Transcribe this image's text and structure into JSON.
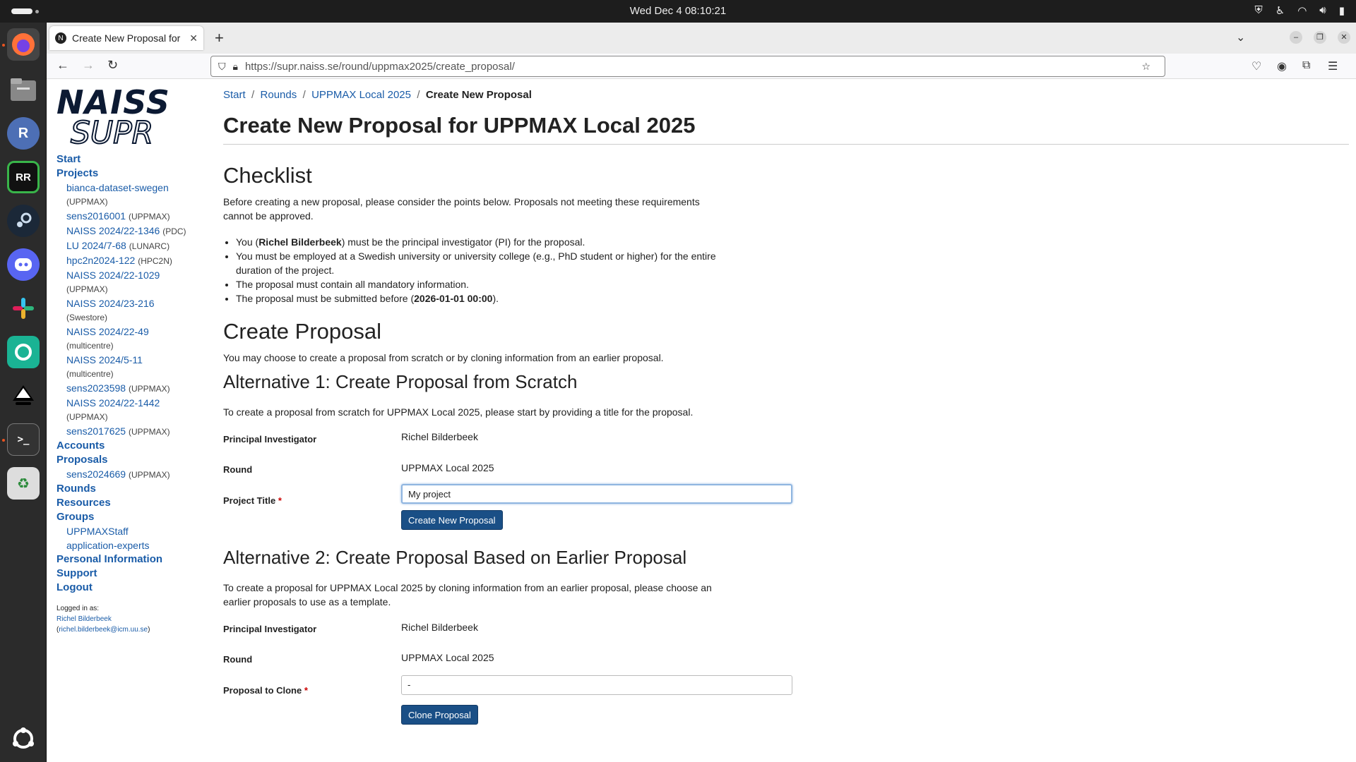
{
  "topbar": {
    "clock": "Wed Dec 4  08:10:21",
    "tray": [
      "shield-icon",
      "accessibility-icon",
      "wifi-icon",
      "volume-icon",
      "battery-icon"
    ]
  },
  "dock": {
    "items": [
      "firefox",
      "files",
      "r-app",
      "rstudio",
      "steam",
      "discord",
      "slack",
      "gitkraken",
      "inkscape",
      "terminal",
      "trash",
      "show-apps"
    ]
  },
  "browser": {
    "tab_title": "Create New Proposal for",
    "favicon_letter": "N",
    "url": "https://supr.naiss.se/round/uppmax2025/create_proposal/"
  },
  "sidebar": {
    "logo_line1": "NAISS",
    "logo_line2": "SUPR",
    "start": "Start",
    "projects": "Projects",
    "project_items": [
      {
        "name": "bianca-dataset-swegen",
        "tag": "(UPPMAX)",
        "wrap": true
      },
      {
        "name": "sens2016001",
        "tag": "(UPPMAX)",
        "wrap": false
      },
      {
        "name": "NAISS 2024/22-1346",
        "tag": "(PDC)",
        "wrap": false
      },
      {
        "name": "LU 2024/7-68",
        "tag": "(LUNARC)",
        "wrap": false
      },
      {
        "name": "hpc2n2024-122",
        "tag": "(HPC2N)",
        "wrap": false
      },
      {
        "name": "NAISS 2024/22-1029",
        "tag": "(UPPMAX)",
        "wrap": true
      },
      {
        "name": "NAISS 2024/23-216",
        "tag": "(Swestore)",
        "wrap": true
      },
      {
        "name": "NAISS 2024/22-49",
        "tag": "(multicentre)",
        "wrap": true
      },
      {
        "name": "NAISS 2024/5-11",
        "tag": "(multicentre)",
        "wrap": true
      },
      {
        "name": "sens2023598",
        "tag": "(UPPMAX)",
        "wrap": false
      },
      {
        "name": "NAISS 2024/22-1442",
        "tag": "(UPPMAX)",
        "wrap": true
      },
      {
        "name": "sens2017625",
        "tag": "(UPPMAX)",
        "wrap": false
      }
    ],
    "accounts": "Accounts",
    "proposals": "Proposals",
    "proposal_item": {
      "name": "sens2024669",
      "tag": "(UPPMAX)"
    },
    "rounds": "Rounds",
    "resources": "Resources",
    "groups": "Groups",
    "group_items": [
      "UPPMAXStaff",
      "application-experts"
    ],
    "personal": "Personal Information",
    "support": "Support",
    "logout": "Logout",
    "logged_in_as": "Logged in as:",
    "user_name": "Richel Bilderbeek",
    "user_email": "richel.bilderbeek@icm.uu.se"
  },
  "breadcrumb": {
    "start": "Start",
    "rounds": "Rounds",
    "round": "UPPMAX Local 2025",
    "current": "Create New Proposal"
  },
  "page_title": "Create New Proposal for UPPMAX Local 2025",
  "checklist": {
    "heading": "Checklist",
    "intro": "Before creating a new proposal, please consider the points below. Proposals not meeting these requirements cannot be approved.",
    "b1_pre": "You (",
    "b1_name": "Richel Bilderbeek",
    "b1_post": ") must be the principal investigator (PI) for the proposal.",
    "b2": "You must be employed at a Swedish university or university college (e.g., PhD student or higher) for the entire duration of the project.",
    "b3": "The proposal must contain all mandatory information.",
    "b4_pre": "The proposal must be submitted before (",
    "b4_date": "2026-01-01 00:00",
    "b4_post": ")."
  },
  "create": {
    "heading": "Create Proposal",
    "intro": "You may choose to create a proposal from scratch or by cloning information from an earlier proposal."
  },
  "alt1": {
    "heading": "Alternative 1: Create Proposal from Scratch",
    "intro": "To create a proposal from scratch for UPPMAX Local 2025, please start by providing a title for the proposal.",
    "pi_label": "Principal Investigator",
    "pi_value": "Richel Bilderbeek",
    "round_label": "Round",
    "round_value": "UPPMAX Local 2025",
    "title_label": "Project Title",
    "title_value": "My project",
    "button": "Create New Proposal"
  },
  "alt2": {
    "heading": "Alternative 2: Create Proposal Based on Earlier Proposal",
    "intro": "To create a proposal for UPPMAX Local 2025 by cloning information from an earlier proposal, please choose an earlier proposals to use as a template.",
    "pi_label": "Principal Investigator",
    "pi_value": "Richel Bilderbeek",
    "round_label": "Round",
    "round_value": "UPPMAX Local 2025",
    "clone_label": "Proposal to Clone",
    "clone_value": "-",
    "button": "Clone Proposal"
  },
  "required_mark": "*"
}
